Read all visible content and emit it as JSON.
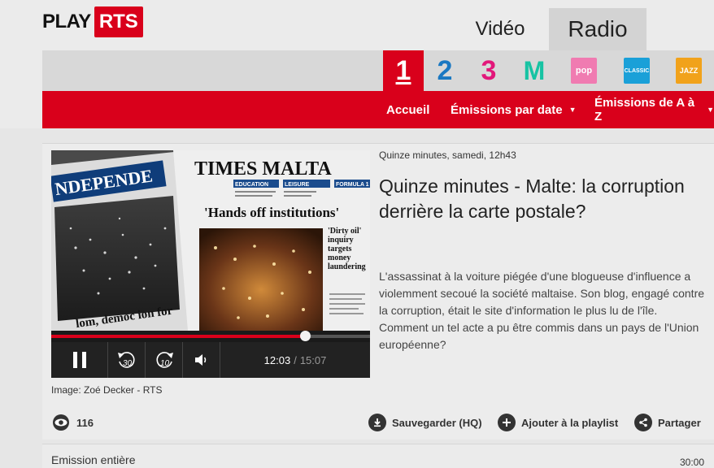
{
  "header": {
    "logo_play": "PLAY",
    "logo_rts": "RTS",
    "tab_video": "Vidéo",
    "tab_radio": "Radio",
    "channels": {
      "one": "1",
      "two": "2",
      "three": "3",
      "m": "M",
      "pop": "pop",
      "classic": "CLASSIC",
      "jazz": "JAZZ"
    },
    "nav": {
      "accueil": "Accueil",
      "date": "Émissions par date",
      "az": "Émissions de A à Z"
    },
    "colors": {
      "brand_red": "#d9001b"
    }
  },
  "player": {
    "progress_fraction": 0.797,
    "current_time": "12:03",
    "separator": "/",
    "duration": "15:07",
    "skip_back_label": "30",
    "skip_forward_label": "10",
    "photo_text": {
      "masthead_left": "NDEPENDE",
      "masthead_right": "TIMES  MALTA",
      "headline": "'Hands off institutions'",
      "section_education": "EDUCATION",
      "section_leisure": "LEISURE",
      "section_formula": "FORMULA 1",
      "side_headline": "'Dirty oil' inquiry targets money laundering",
      "bottom_left": "lom, democ ion for"
    }
  },
  "caption": "Image: Zoé Decker - RTS",
  "episode": {
    "meta": "Quinze minutes, samedi, 12h43",
    "title": "Quinze minutes - Malte: la corruption derrière la carte postale?",
    "description": "L'assassinat à la voiture piégée d'une blogueuse d'influence a violemment secoué la société maltaise. Son blog, engagé contre la corruption, était le site d'information le plus lu de l'île. Comment un tel acte a pu être commis dans un pays de l'Union européenne?"
  },
  "stats": {
    "views": "116"
  },
  "actions": {
    "save": "Sauvegarder (HQ)",
    "playlist": "Ajouter à la playlist",
    "share": "Partager"
  },
  "bottom": {
    "label": "Emission entière",
    "duration": "30:00"
  }
}
